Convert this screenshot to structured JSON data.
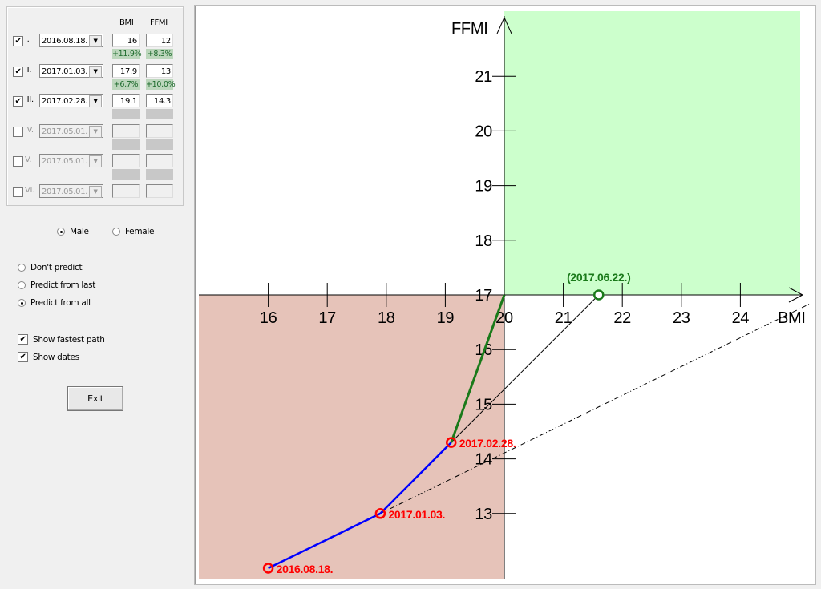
{
  "table": {
    "bmi_header": "BMI",
    "ffmi_header": "FFMI",
    "rows": [
      {
        "checked": true,
        "label": "I.",
        "date": "2016.08.18.",
        "bmi": "16",
        "ffmi": "12",
        "enabled": true
      },
      {
        "checked": true,
        "label": "II.",
        "date": "2017.01.03.",
        "bmi": "17.9",
        "ffmi": "13",
        "enabled": true
      },
      {
        "checked": true,
        "label": "III.",
        "date": "2017.02.28.",
        "bmi": "19.1",
        "ffmi": "14.3",
        "enabled": true
      },
      {
        "checked": false,
        "label": "IV.",
        "date": "2017.05.01.",
        "bmi": "",
        "ffmi": "",
        "enabled": false
      },
      {
        "checked": false,
        "label": "V.",
        "date": "2017.05.01.",
        "bmi": "",
        "ffmi": "",
        "enabled": false
      },
      {
        "checked": false,
        "label": "VI.",
        "date": "2017.05.01.",
        "bmi": "",
        "ffmi": "",
        "enabled": false
      }
    ],
    "changes": [
      {
        "bmi": "+11.9%",
        "ffmi": "+8.3%"
      },
      {
        "bmi": "+6.7%",
        "ffmi": "+10.0%"
      },
      {
        "bmi": "",
        "ffmi": ""
      },
      {
        "bmi": "",
        "ffmi": ""
      },
      {
        "bmi": "",
        "ffmi": ""
      }
    ]
  },
  "gender": {
    "male": "Male",
    "female": "Female",
    "selected": "male"
  },
  "prediction": {
    "options": [
      "Don't predict",
      "Predict from last",
      "Predict from all"
    ],
    "selected": 2
  },
  "checks": {
    "fastest_path": "Show fastest path",
    "fastest_path_checked": true,
    "dates": "Show dates",
    "dates_checked": true
  },
  "exit_label": "Exit",
  "chart_data": {
    "type": "line",
    "xlabel": "BMI",
    "ylabel": "FFMI",
    "xlim": [
      12,
      25
    ],
    "ylim": [
      11.8,
      22.2
    ],
    "x_ticks": [
      "16",
      "17",
      "18",
      "19",
      "20",
      "21",
      "22",
      "23",
      "24"
    ],
    "y_ticks": [
      "13",
      "14",
      "15",
      "16",
      "17",
      "18",
      "19",
      "20",
      "21"
    ],
    "origin": {
      "bmi": 20,
      "ffmi": 17
    },
    "colors": {
      "measured": "#0000ff",
      "points": "#ff0000",
      "fastest": "#1a7a1a",
      "good_zone": "#ccffcc",
      "bad_zone": "#e6c3b9"
    },
    "measured": [
      {
        "bmi": 16,
        "ffmi": 12,
        "date": "2016.08.18."
      },
      {
        "bmi": 17.9,
        "ffmi": 13,
        "date": "2017.01.03."
      },
      {
        "bmi": 19.1,
        "ffmi": 14.3,
        "date": "2017.02.28."
      }
    ],
    "fastest_path": [
      {
        "bmi": 19.1,
        "ffmi": 14.3
      },
      {
        "bmi": 20,
        "ffmi": 17
      }
    ],
    "prediction": {
      "bmi": 21.6,
      "ffmi": 17,
      "date": "(2017.06.22.)"
    },
    "trend_line": [
      {
        "bmi": 17.9,
        "ffmi": 13
      },
      {
        "bmi": 25.2,
        "ffmi": 16.85
      }
    ]
  }
}
